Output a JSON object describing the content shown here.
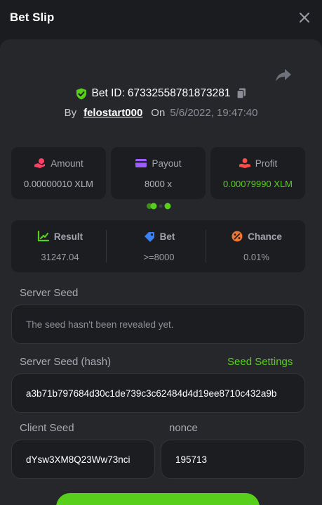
{
  "header": {
    "title": "Bet Slip"
  },
  "bet": {
    "id_label": "Bet ID:",
    "id_value": "67332558781873281",
    "by_label": "By",
    "username": "felostart000",
    "on_label": "On",
    "date": "5/6/2022, 19:47:40"
  },
  "stats": [
    {
      "label": "Amount",
      "value": "0.00000010 XLM",
      "icon": "coins-hand-icon",
      "color": "#ff3f66"
    },
    {
      "label": "Payout",
      "value": "8000 x",
      "icon": "card-icon",
      "color": "#9c5cff"
    },
    {
      "label": "Profit",
      "value": "0.00079990 XLM",
      "icon": "hand-coin-icon",
      "color": "#ff4a4a"
    }
  ],
  "results": [
    {
      "label": "Result",
      "value": "31247.04",
      "icon": "chart-icon",
      "color": "#58d01b"
    },
    {
      "label": "Bet",
      "value": ">=8000",
      "icon": "tag-icon",
      "color": "#3b82f6"
    },
    {
      "label": "Chance",
      "value": "0.01%",
      "icon": "percent-icon",
      "color": "#f2762e"
    }
  ],
  "seeds": {
    "server_seed_label": "Server Seed",
    "server_seed_value": "The seed hasn't been revealed yet.",
    "server_hash_label": "Server Seed (hash)",
    "seed_settings_label": "Seed Settings",
    "server_hash_value": "a3b71b797684d30c1de739c3c62484d4d19ee8710c432a9b",
    "client_seed_label": "Client Seed",
    "client_seed_value": "dYsw3XM8Q23Ww73nci",
    "nonce_label": "nonce",
    "nonce_value": "195713"
  },
  "colors": {
    "accent": "#58d01b",
    "panel": "#26272b",
    "card": "#1c1d20"
  }
}
